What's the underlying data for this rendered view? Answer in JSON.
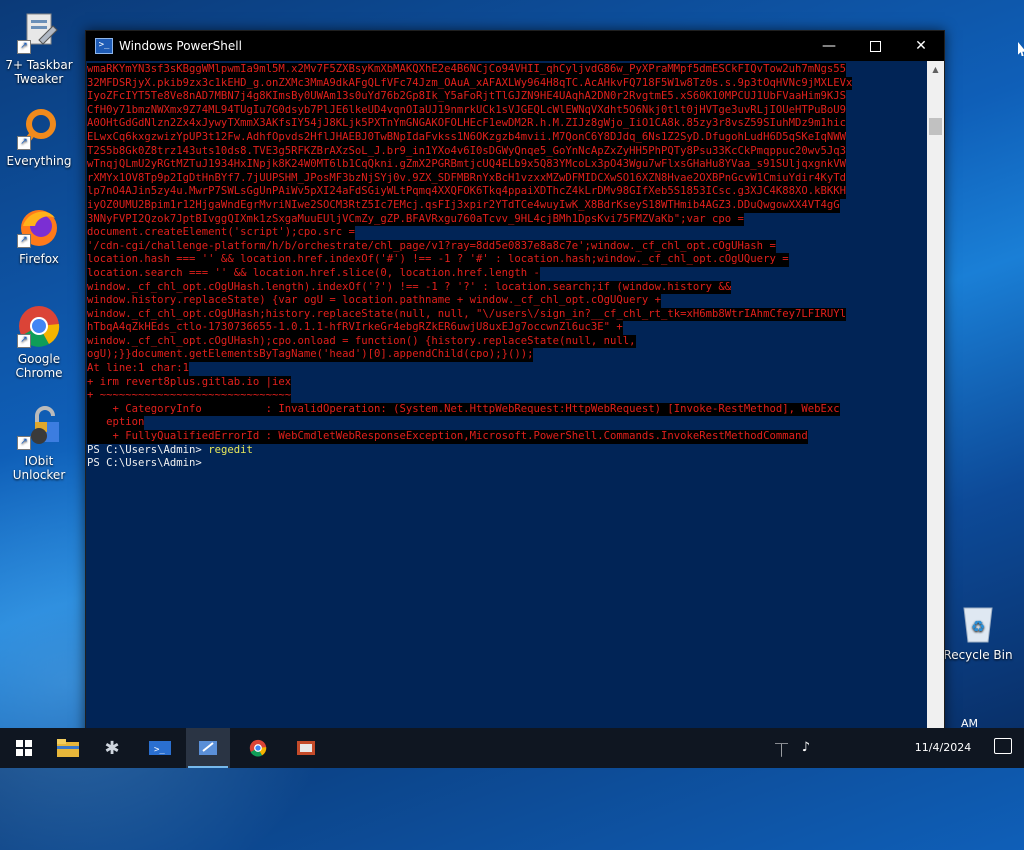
{
  "desktop": {
    "icons": [
      {
        "label": "7+ Taskbar Tweaker",
        "icon": "taskbar-tweaker-icon"
      },
      {
        "label": "Everything",
        "icon": "everything-search-icon"
      },
      {
        "label": "Firefox",
        "icon": "firefox-icon"
      },
      {
        "label": "Google Chrome",
        "icon": "chrome-icon"
      },
      {
        "label": "IObit Unlocker",
        "icon": "iobit-unlocker-icon"
      }
    ],
    "recycle_bin": {
      "label": "Recycle Bin",
      "icon": "recycle-bin-icon"
    }
  },
  "window": {
    "title": "Windows PowerShell",
    "controls": {
      "minimize": "—",
      "close": "✕"
    }
  },
  "console": {
    "lines": [
      {
        "text": "wmaRKYmYN3sf3sKBggWMlpwmIa9ml5M.x2Mv7F5ZXBsyKmXbMAKQXhE2e4B6NCjCo94VHII_qhCyljvdG86w_PyXPraMMpf5dmESCkFIQvTow2uh7mNgs55",
        "style": "err"
      },
      {
        "text": "32MFDSRjyX.pkib9zx3c1kEHD_g.onZXMc3MmA9dkAFgQLfVFc74Jzm_OAuA_xAFAXLWy964H8qTC.AcAHkvFQ718F5W1w8Tz0s.s.9p3tOqHVNc9jMXLEVx",
        "style": "err"
      },
      {
        "text": "IyoZFcIYT5Te8Ve8nAD7MBN7j4g8KImsBy0UWAm13s0uYd76b2Gp8Ik_Y5aFoRjtTlGJZN9HE4UAqhA2DN0r2RvgtmE5.xS60K10MPCUJ1UbFVaaHim9KJS",
        "style": "err"
      },
      {
        "text": "CfH0y71bmzNWXmx9Z74ML94TUgIu7G0dsyb7PlJE6lkeUD4vqnOIaUJ19nmrkUCk1sVJGEQLcWlEWNqVXdht5O6Nkj0tlt0jHVTge3uvRLjIOUeHTPuBoU9",
        "style": "err"
      },
      {
        "text": "A0OHtGdGdNlzn2Zx4xJywyTXmmX3AKfsIY54jJ8KLjk5PXTnYmGNGAKOFOLHEcF1ewDM2R.h.M.ZIJz8gWjo_IiO1CA8k.85zy3r8vsZ59SIuhMDz9m1hic",
        "style": "err"
      },
      {
        "text": "ELwxCq6kxgzwizYpUP3t12Fw.AdhfOpvds2HflJHAEBJ0TwBNpIdaFvkss1N6OKzgzb4mvii.M7QonC6Y8DJdq_6Ns1Z2SyD.DfugohLudH6D5qSKeIqNWW",
        "style": "err"
      },
      {
        "text": "T2S5b8Gk0Z8trz143uts10ds8.TVE3g5RFKZBrAXzSoL_J.br9_in1YXo4v6I0sDGWyQnqe5_GoYnNcApZxZyHH5PhPQTy8Psu33KcCkPmqppuc20wv5Jq3",
        "style": "err"
      },
      {
        "text": "wTnqjQLmU2yRGtMZTuJ1934HxINpjk8K24W0MT6lb1CqQkni.gZmX2PGRBmtjcUQ4ELb9x5Q83YMcoLx3pO43Wgu7wFlxsGHaHu8YVaa_s91SUljqxgnkVW",
        "style": "err"
      },
      {
        "text": "rXMYx1OV8Tp9p2IgDtHnBYf7.7jUUPSHM_JPosMF3bzNjSYj0v.9ZX_SDFMBRnYxBcH1vzxxMZwDFMIDCXwSO16XZN8Hvae2OXBPnGcvW1CmiuYdir4KyTd",
        "style": "err"
      },
      {
        "text": "lp7nO4AJin5zy4u.MwrP7SWLsGgUnPAiWv5pXI24aFdSGiyWLtPqmq4XXQFOK6Tkq4ppaiXDThcZ4kLrDMv98GIfXeb5S1853ICsc.g3XJC4K88XO.kBKKH",
        "style": "err"
      },
      {
        "text": "iyOZ0UMU2Bpim1r12HjgaWndEgrMvriNIwe2SOCM3RtZ5Ic7EMcj.qsFIj3xpir2YTdTCe4wuyIwK_X8BdrKseyS18WTHmib4AGZ3.DDuQwgowXX4VT4gG",
        "style": "err"
      },
      {
        "text": "3NNyFVPI2Qzok7JptBIvggQIXmk1zSxgaMuuEUljVCmZy_gZP.BFAVRxgu760aTcvv_9HL4cjBMh1DpsKvi75FMZVaKb\";var cpo =",
        "style": "err"
      },
      {
        "text": "document.createElement('script');cpo.src =",
        "style": "err"
      },
      {
        "text": "'/cdn-cgi/challenge-platform/h/b/orchestrate/chl_page/v1?ray=8dd5e0837e8a8c7e';window._cf_chl_opt.cOgUHash =",
        "style": "err"
      },
      {
        "text": "location.hash === '' && location.href.indexOf('#') !== -1 ? '#' : location.hash;window._cf_chl_opt.cOgUQuery =",
        "style": "err"
      },
      {
        "text": "location.search === '' && location.href.slice(0, location.href.length -",
        "style": "err"
      },
      {
        "text": "window._cf_chl_opt.cOgUHash.length).indexOf('?') !== -1 ? '?' : location.search;if (window.history &&",
        "style": "err"
      },
      {
        "text": "window.history.replaceState) {var ogU = location.pathname + window._cf_chl_opt.cOgUQuery +",
        "style": "err"
      },
      {
        "text": "window._cf_chl_opt.cOgUHash;history.replaceState(null, null, \"\\/users\\/sign_in?__cf_chl_rt_tk=xH6mb8WtrIAhmCfey7LFIRUYl",
        "style": "err"
      },
      {
        "text": "hTbqA4qZkHEds_ctlo-1730736655-1.0.1.1-hfRVIrkeGr4ebgRZkER6uwjU8uxEJg7occwnZl6uc3E\" +",
        "style": "err"
      },
      {
        "text": "window._cf_chl_opt.cOgUHash);cpo.onload = function() {history.replaceState(null, null,",
        "style": "err"
      },
      {
        "text": "ogU);}}document.getElementsByTagName('head')[0].appendChild(cpo);}());",
        "style": "err"
      },
      {
        "text": "At line:1 char:1",
        "style": "err"
      },
      {
        "text": "+ irm revert8plus.gitlab.io |iex",
        "style": "err"
      },
      {
        "text": "+ ~~~~~~~~~~~~~~~~~~~~~~~~~~~~~~",
        "style": "err"
      },
      {
        "text": "    + CategoryInfo          : InvalidOperation: (System.Net.HttpWebRequest:HttpWebRequest) [Invoke-RestMethod], WebExc",
        "style": "err"
      },
      {
        "text": "   eption",
        "style": "err"
      },
      {
        "text": "    + FullyQualifiedErrorId : WebCmdletWebResponseException,Microsoft.PowerShell.Commands.InvokeRestMethodCommand",
        "style": "err"
      },
      {
        "prompt": "PS C:\\Users\\Admin> ",
        "command": "regedit",
        "style": "prompt"
      },
      {
        "prompt": "PS C:\\Users\\Admin>",
        "command": "",
        "style": "prompt"
      }
    ]
  },
  "taskbar": {
    "items": [
      {
        "icon": "file-explorer-icon"
      },
      {
        "icon": "settings-gear-icon"
      },
      {
        "icon": "powershell-icon"
      },
      {
        "icon": "taskbar-tweaker-icon"
      },
      {
        "icon": "chrome-icon"
      },
      {
        "icon": "app-icon"
      }
    ],
    "clock": {
      "time": "AM",
      "date": "11/4/2024"
    }
  }
}
